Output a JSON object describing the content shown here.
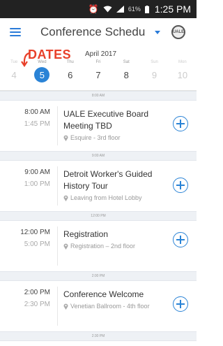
{
  "status_bar": {
    "battery": "61%",
    "time": "1:25 PM"
  },
  "app_bar": {
    "title": "Conference Schedu...",
    "logo_text": "UALE"
  },
  "annotation": {
    "text": "DATES",
    "color": "#e8402a"
  },
  "date_bar": {
    "month": "April 2017",
    "days": [
      {
        "name": "Tue",
        "num": "4"
      },
      {
        "name": "Wed",
        "num": "5",
        "selected": true
      },
      {
        "name": "Thu",
        "num": "6"
      },
      {
        "name": "Fri",
        "num": "7"
      },
      {
        "name": "Sat",
        "num": "8"
      },
      {
        "name": "Sun",
        "num": "9"
      },
      {
        "name": "Mon",
        "num": "10"
      }
    ]
  },
  "schedule": [
    {
      "divider": "8:00 AM",
      "start": "8:00 AM",
      "end": "1:45 PM",
      "title1": "UALE Executive Board",
      "title2": "Meeting TBD",
      "location": "Esquire - 3rd floor"
    },
    {
      "divider": "9:00 AM",
      "start": "9:00 AM",
      "end": "1:00 PM",
      "title1": "Detroit Worker's Guided",
      "title2": "History Tour",
      "location": "Leaving from Hotel Lobby"
    },
    {
      "divider": "12:00 PM",
      "start": "12:00 PM",
      "end": "5:00 PM",
      "title1": "Registration",
      "title2": "",
      "location": "Registration – 2nd floor"
    },
    {
      "divider": "2:00 PM",
      "start": "2:00 PM",
      "end": "2:30 PM",
      "title1": "Conference Welcome",
      "title2": "",
      "location": "Venetian Ballroom - 4th floor"
    }
  ],
  "trailing_divider": "2:30 PM",
  "colors": {
    "accent": "#2a83d6",
    "status_bar": "#222222"
  }
}
